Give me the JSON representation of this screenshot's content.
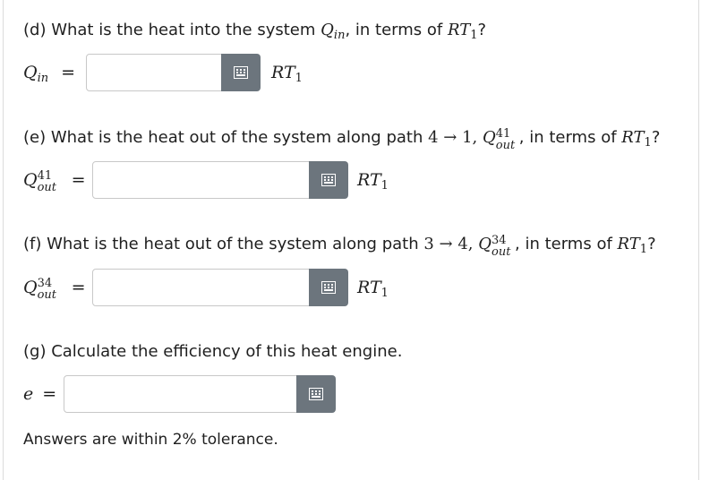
{
  "parts": [
    {
      "question_prefix": "(d) What is the heat into the system",
      "question_symbol": "Q",
      "question_symbol_sub": "in",
      "question_suffix": ", in terms of",
      "question_unit_R": "RT",
      "question_unit_sub": "1",
      "question_end": "?",
      "lhs_symbol": "Q",
      "lhs_sub": "in",
      "equals": "=",
      "input_value": "",
      "unit_text": "RT",
      "unit_sub": "1"
    },
    {
      "question_prefix": "(e) What is the heat out of the system along path",
      "path_text": "4 → 1,",
      "question_symbol": "Q",
      "question_symbol_sup": "41",
      "question_symbol_sub": "out",
      "question_suffix": ", in terms of",
      "question_unit_R": "RT",
      "question_unit_sub": "1",
      "question_end": "?",
      "lhs_symbol": "Q",
      "lhs_sup": "41",
      "lhs_sub": "out",
      "equals": "=",
      "input_value": "",
      "unit_text": "RT",
      "unit_sub": "1"
    },
    {
      "question_prefix": "(f) What is the heat out of the system along path",
      "path_text": "3 → 4,",
      "question_symbol": "Q",
      "question_symbol_sup": "34",
      "question_symbol_sub": "out",
      "question_suffix": ", in terms of",
      "question_unit_R": "RT",
      "question_unit_sub": "1",
      "question_end": "?",
      "lhs_symbol": "Q",
      "lhs_sup": "34",
      "lhs_sub": "out",
      "equals": "=",
      "input_value": "",
      "unit_text": "RT",
      "unit_sub": "1"
    },
    {
      "question_prefix": "(g) Calculate the efficiency of this heat engine.",
      "lhs_symbol": "e",
      "equals": "=",
      "input_value": ""
    }
  ],
  "tolerance_note": "Answers are within 2% tolerance.",
  "icons": {
    "keyboard_button": "keyboard-icon"
  },
  "colors": {
    "keyboard_button_bg": "#6c757d",
    "field_border": "#c8c8c8"
  }
}
